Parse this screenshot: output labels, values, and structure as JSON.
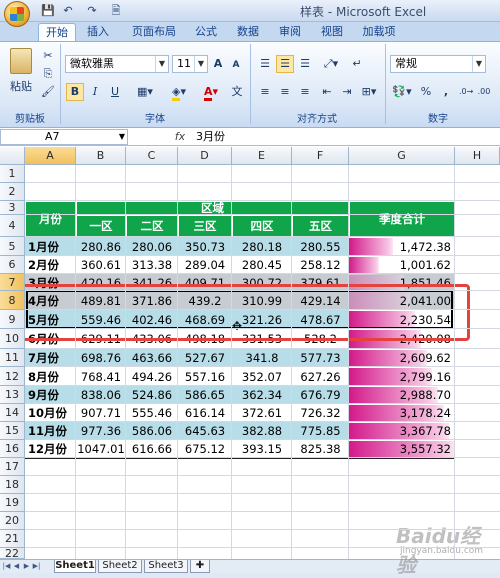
{
  "window": {
    "title": "样表 - Microsoft Excel"
  },
  "qat": [
    "💾",
    "↶",
    "↷",
    "🗎"
  ],
  "ribbon_tabs": [
    "开始",
    "插入",
    "页面布局",
    "公式",
    "数据",
    "审阅",
    "视图",
    "加载项"
  ],
  "active_tab": "开始",
  "ribbon": {
    "clipboard": {
      "paste_label": "粘贴",
      "group_label": "剪贴板"
    },
    "font": {
      "font_name": "微软雅黑",
      "font_size": "11",
      "grow": "A",
      "shrink": "A",
      "bold": "B",
      "italic": "I",
      "underline": "U",
      "group_label": "字体"
    },
    "alignment": {
      "group_label": "对齐方式"
    },
    "number": {
      "format": "常规",
      "percent": "%",
      "comma": ",",
      "group_label": "数字"
    }
  },
  "formula_bar": {
    "cell_ref": "A7",
    "fx": "fx",
    "content": "3月份"
  },
  "columns": [
    "A",
    "B",
    "C",
    "D",
    "E",
    "F",
    "G",
    "H"
  ],
  "rows": [
    "1",
    "2",
    "3",
    "4",
    "5",
    "6",
    "7",
    "8",
    "9",
    "10",
    "11",
    "12",
    "13",
    "14",
    "15",
    "16",
    "17",
    "18",
    "19",
    "20",
    "21",
    "22"
  ],
  "table": {
    "month_header": "月份",
    "region_header": "区域",
    "total_header": "季度合计",
    "districts": [
      "一区",
      "二区",
      "三区",
      "四区",
      "五区"
    ],
    "data_rows": [
      {
        "month": "1月份",
        "values": [
          "280.86",
          "280.06",
          "350.73",
          "280.18",
          "280.55"
        ],
        "total": "1,472.38",
        "amount": 1472.38
      },
      {
        "month": "2月份",
        "values": [
          "360.61",
          "313.38",
          "289.04",
          "280.45",
          "258.12"
        ],
        "total": "1,001.62",
        "amount": 1001.62
      },
      {
        "month": "3月份",
        "values": [
          "420.16",
          "341.26",
          "409.71",
          "300.72",
          "379.61"
        ],
        "total": "1,851.46",
        "amount": 1851.46
      },
      {
        "month": "4月份",
        "values": [
          "489.81",
          "371.86",
          "439.2",
          "310.99",
          "429.14"
        ],
        "total": "2,041.00",
        "amount": 2041.0
      },
      {
        "month": "5月份",
        "values": [
          "559.46",
          "402.46",
          "468.69",
          "321.26",
          "478.67"
        ],
        "total": "2,230.54",
        "amount": 2230.54
      },
      {
        "month": "6月份",
        "values": [
          "629.11",
          "433.06",
          "498.18",
          "331.53",
          "528.2"
        ],
        "total": "2,420.08",
        "amount": 2420.08
      },
      {
        "month": "7月份",
        "values": [
          "698.76",
          "463.66",
          "527.67",
          "341.8",
          "577.73"
        ],
        "total": "2,609.62",
        "amount": 2609.62
      },
      {
        "month": "8月份",
        "values": [
          "768.41",
          "494.26",
          "557.16",
          "352.07",
          "627.26"
        ],
        "total": "2,799.16",
        "amount": 2799.16
      },
      {
        "month": "9月份",
        "values": [
          "838.06",
          "524.86",
          "586.65",
          "362.34",
          "676.79"
        ],
        "total": "2,988.70",
        "amount": 2988.7
      },
      {
        "month": "10月份",
        "values": [
          "907.71",
          "555.46",
          "616.14",
          "372.61",
          "726.32"
        ],
        "total": "3,178.24",
        "amount": 3178.24
      },
      {
        "month": "11月份",
        "values": [
          "977.36",
          "586.06",
          "645.63",
          "382.88",
          "775.85"
        ],
        "total": "3,367.78",
        "amount": 3367.78
      },
      {
        "month": "12月份",
        "values": [
          "1047.01",
          "616.66",
          "675.12",
          "393.15",
          "825.38"
        ],
        "total": "3,557.32",
        "amount": 3557.32
      }
    ],
    "max_amount": 3557.32
  },
  "sheets": [
    "Sheet1",
    "Sheet2",
    "Sheet3"
  ],
  "watermark": {
    "brand": "Baidu经验",
    "url": "jingyan.baidu.com"
  },
  "colors": {
    "header_green": "#10a54a",
    "band_blue": "#b7dde8",
    "band_gray": "#c7ccd2",
    "bar_pink": "#d3198a",
    "highlight_red": "#e4433d"
  }
}
